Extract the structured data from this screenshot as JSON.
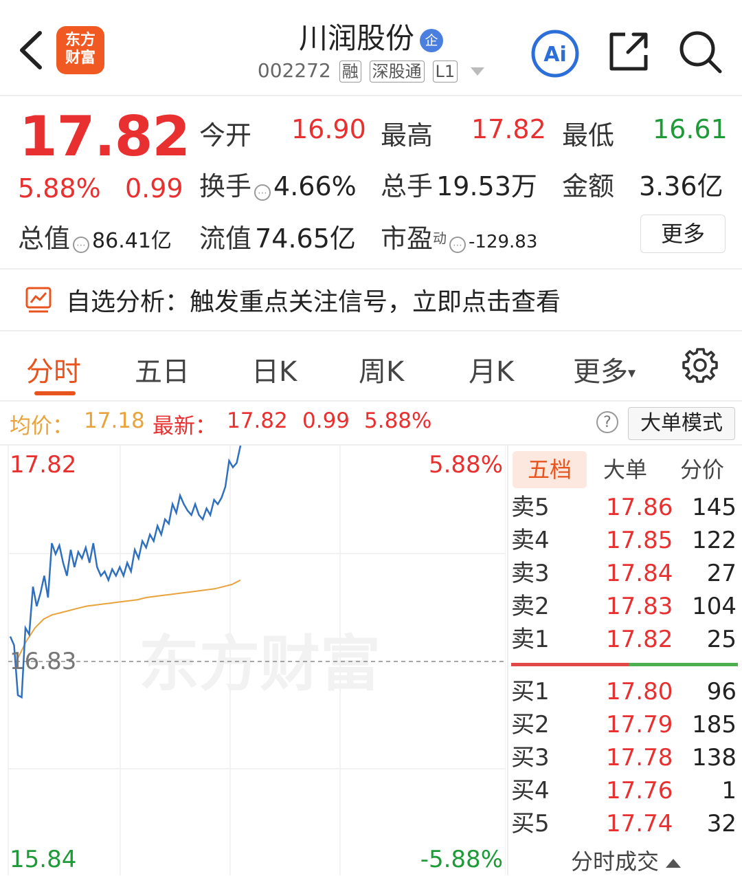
{
  "header": {
    "logo_line1": "东方",
    "logo_line2": "财富",
    "title": "川润股份",
    "title_badge": "企",
    "code": "002272",
    "tags": [
      "融",
      "深股通",
      "L1"
    ]
  },
  "quote": {
    "price": "17.82",
    "change_pct": "5.88%",
    "change": "0.99",
    "open_label": "今开",
    "open": "16.90",
    "high_label": "最高",
    "high": "17.82",
    "low_label": "最低",
    "low": "16.61",
    "turnover_label": "换手",
    "turnover": "4.66%",
    "volume_label": "总手",
    "volume": "19.53万",
    "amount_label": "金额",
    "amount": "3.36亿",
    "mktcap_label": "总值",
    "mktcap": "86.41亿",
    "float_label": "流值",
    "float": "74.65亿",
    "pe_label": "市盈",
    "pe_sup": "动",
    "pe": "-129.83",
    "more_label": "更多"
  },
  "signal": {
    "text": "自选分析：触发重点关注信号，立即点击查看"
  },
  "tabs": [
    "分时",
    "五日",
    "日K",
    "周K",
    "月K",
    "更多"
  ],
  "avg_line": {
    "avg_label": "均价：",
    "avg_value": "17.18",
    "latest_label": "最新：",
    "latest_value": "17.82",
    "latest_change": "0.99",
    "latest_pct": "5.88%",
    "help": "?",
    "big_order_label": "大单模式"
  },
  "chart_data": {
    "type": "line",
    "y_top_label": "17.82",
    "y_mid_label": "16.83",
    "y_bottom_label": "15.84",
    "pct_top_label": "5.88%",
    "pct_bottom_label": "-5.88%",
    "ylim": [
      15.84,
      17.82
    ],
    "watermark": "东方财富",
    "series": [
      {
        "color": "#2e6fc0",
        "values": [
          16.94,
          16.9,
          16.67,
          16.66,
          16.98,
          16.95,
          17.17,
          17.08,
          17.14,
          17.22,
          17.12,
          17.37,
          17.32,
          17.36,
          17.28,
          17.22,
          17.34,
          17.26,
          17.33,
          17.3,
          17.35,
          17.28,
          17.37,
          17.26,
          17.22,
          17.24,
          17.2,
          17.25,
          17.22,
          17.26,
          17.22,
          17.28,
          17.24,
          17.34,
          17.3,
          17.38,
          17.35,
          17.41,
          17.38,
          17.45,
          17.41,
          17.48,
          17.46,
          17.55,
          17.51,
          17.59,
          17.55,
          17.52,
          17.5,
          17.55,
          17.5,
          17.48,
          17.53,
          17.5,
          17.57,
          17.55,
          17.58,
          17.63,
          17.75,
          17.72,
          17.74,
          17.82
        ]
      },
      {
        "color": "#e8a33c",
        "values": [
          16.84,
          16.92,
          16.98,
          17.02,
          17.04,
          17.05,
          17.06,
          17.07,
          17.08,
          17.085,
          17.09,
          17.095,
          17.1,
          17.105,
          17.11,
          17.12,
          17.125,
          17.13,
          17.135,
          17.14,
          17.145,
          17.15,
          17.155,
          17.16,
          17.17,
          17.18,
          17.2
        ]
      }
    ]
  },
  "order_book": {
    "tabs": [
      "五档",
      "大单",
      "分价"
    ],
    "asks": [
      {
        "label": "卖5",
        "price": "17.86",
        "vol": "145"
      },
      {
        "label": "卖4",
        "price": "17.85",
        "vol": "122"
      },
      {
        "label": "卖3",
        "price": "17.84",
        "vol": "27"
      },
      {
        "label": "卖2",
        "price": "17.83",
        "vol": "104"
      },
      {
        "label": "卖1",
        "price": "17.82",
        "vol": "25"
      }
    ],
    "bids": [
      {
        "label": "买1",
        "price": "17.80",
        "vol": "96"
      },
      {
        "label": "买2",
        "price": "17.79",
        "vol": "185"
      },
      {
        "label": "买3",
        "price": "17.78",
        "vol": "138"
      },
      {
        "label": "买4",
        "price": "17.76",
        "vol": "1"
      },
      {
        "label": "买5",
        "price": "17.74",
        "vol": "32"
      }
    ],
    "footer": "分时成交"
  }
}
